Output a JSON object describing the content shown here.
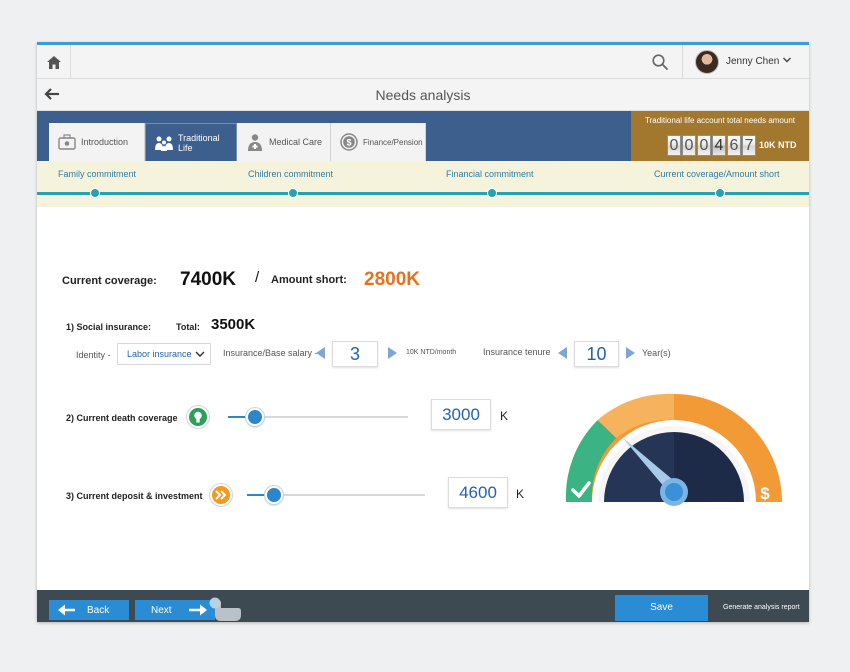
{
  "colors": {
    "accent_blue": "#2a8cd5",
    "header_blue": "#3c5f8d",
    "gold": "#a2782f",
    "teal": "#26a2b0",
    "amount_short_orange": "#e8711d",
    "gauge_green": "#3bb382",
    "gauge_orange": "#f29a35",
    "gauge_navy": "#253556"
  },
  "topbar": {
    "home_icon": "home-icon",
    "search_icon": "search-icon",
    "user_name": "Jenny Chen",
    "user_caret_icon": "chevron-down-icon"
  },
  "title": {
    "back_icon": "back-arrow-icon",
    "text": "Needs analysis"
  },
  "tabs": [
    {
      "label": "Introduction",
      "icon": "briefcase-icon",
      "active": false
    },
    {
      "label": "Traditional Life",
      "icon": "family-icon",
      "active": true
    },
    {
      "label": "Medical Care",
      "icon": "doctor-icon",
      "active": false
    },
    {
      "label": "Finance/Pension",
      "icon": "dollar-coin-icon",
      "active": false
    }
  ],
  "needs_total": {
    "label": "Traditional life account total needs amount",
    "digits": [
      "0",
      "0",
      "0",
      "4",
      "6",
      "7"
    ],
    "unit": "10K NTD"
  },
  "timeline": {
    "steps": [
      "Family commitment",
      "Children commitment",
      "Financial commitment",
      "Current coverage/Amount short"
    ]
  },
  "summary": {
    "coverage_label": "Current coverage:",
    "coverage_value": "7400K",
    "separator": "/",
    "short_label": "Amount short:",
    "short_value": "2800K"
  },
  "social": {
    "heading": "1) Social insurance:",
    "total_label": "Total:",
    "total_value": "3500K",
    "identity_label": "Identity -",
    "identity_value": "Labor insurance",
    "salary_label": "Insurance/Base salary -",
    "salary_value": "3",
    "salary_unit": "10K NTD/month",
    "tenure_label": "Insurance tenure",
    "tenure_value": "10",
    "tenure_unit": "Year(s)"
  },
  "death": {
    "label": "2) Current death coverage",
    "icon": "lightbulb-icon",
    "value": "3000",
    "unit": "K",
    "slider_fraction": 0.15
  },
  "deposit": {
    "label": "3) Current deposit & investment",
    "icon": "double-chevron-right-icon",
    "value": "4600",
    "unit": "K",
    "slider_fraction": 0.15
  },
  "gauge": {
    "left_icon": "checkmark-icon",
    "right_icon": "dollar-icon",
    "needle_icon": "gauge-needle-icon"
  },
  "footer": {
    "back_label": "Back",
    "next_label": "Next",
    "save_label": "Save",
    "report_label": "Generate analysis report"
  }
}
